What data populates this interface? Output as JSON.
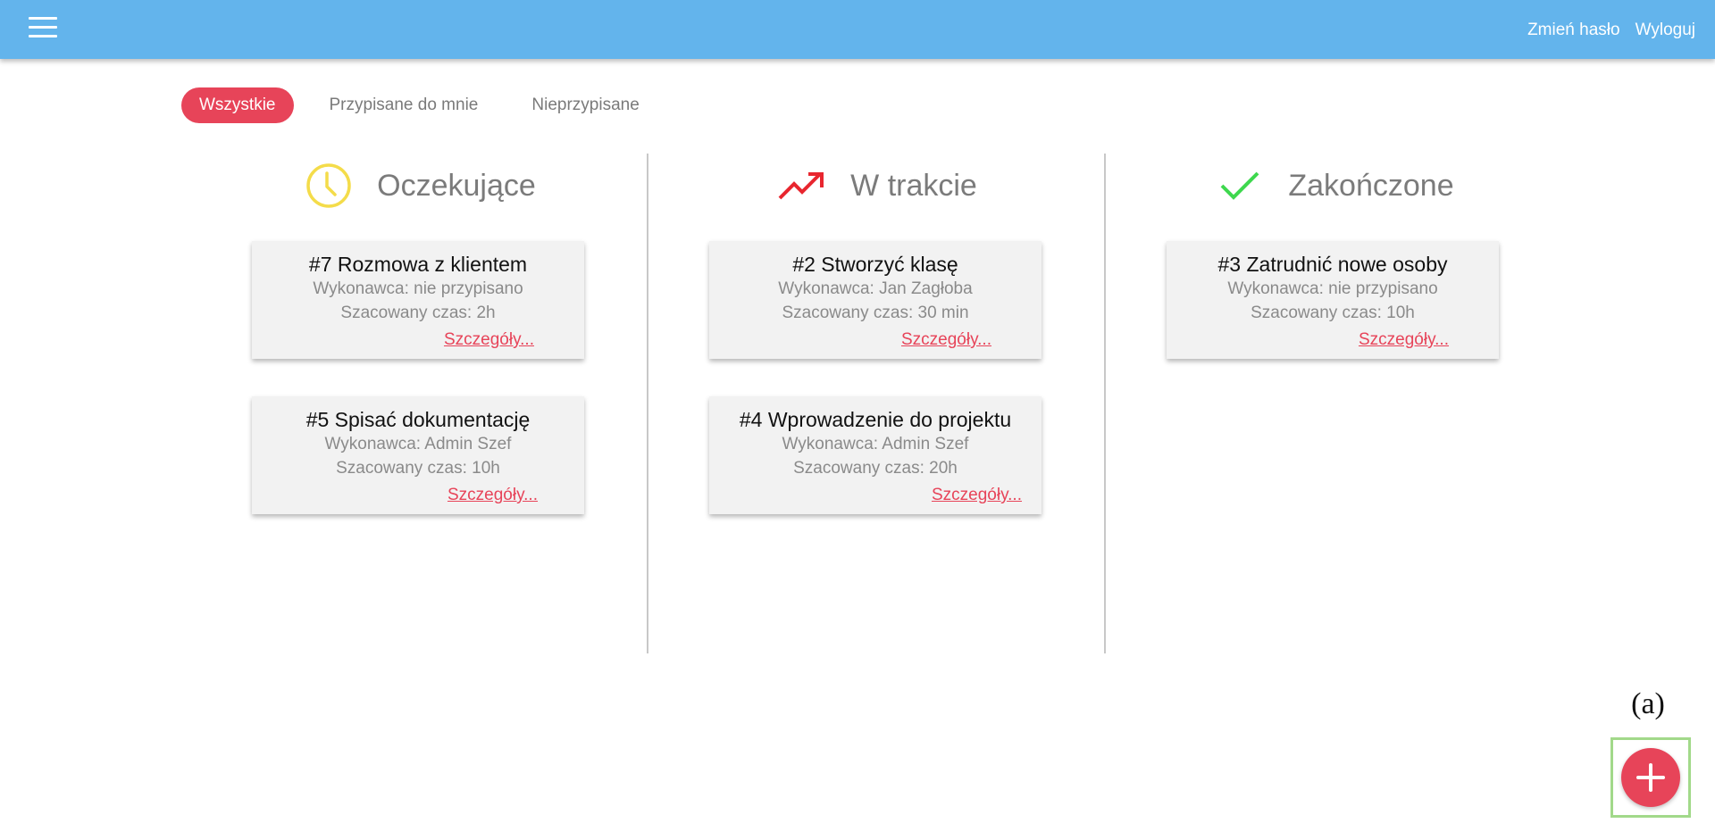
{
  "topbar": {
    "menu_icon": "hamburger-menu-icon",
    "actions": {
      "change_password": "Zmień hasło",
      "logout": "Wyloguj"
    },
    "color": "#63b4ec"
  },
  "filters": {
    "items": [
      "Wszystkie",
      "Przypisane do mnie",
      "Nieprzypisane"
    ],
    "active": "Wszystkie",
    "active_color": "#e74459"
  },
  "columns": [
    {
      "title": "Oczekujące",
      "icon": "clock-icon",
      "icon_color": "#f4dc4a",
      "cards": [
        {
          "title": "#7 Rozmowa z klientem",
          "assignee": "Wykonawca: nie przypisano",
          "estimate": "Szacowany czas: 2h",
          "link": "Szczegóły..."
        },
        {
          "title": "#5 Spisać dokumentację",
          "assignee": "Wykonawca: Admin Szef",
          "estimate": "Szacowany czas: 10h",
          "link": "Szczegóły..."
        }
      ]
    },
    {
      "title": "W trakcie",
      "icon": "trending-up-icon",
      "icon_color": "#e8262f",
      "cards": [
        {
          "title": "#2 Stworzyć klasę",
          "assignee": "Wykonawca: Jan Zagłoba",
          "estimate": "Szacowany czas: 30 min",
          "link": "Szczegóły..."
        },
        {
          "title": "#4 Wprowadzenie do projektu",
          "assignee": "Wykonawca: Admin Szef",
          "estimate": "Szacowany czas: 20h",
          "link": "Szczegóły..."
        }
      ]
    },
    {
      "title": "Zakończone",
      "icon": "checkmark-icon",
      "icon_color": "#3ed84e",
      "cards": [
        {
          "title": "#3 Zatrudnić nowe osoby",
          "assignee": "Wykonawca: nie przypisano",
          "estimate": "Szacowany czas: 10h",
          "link": "Szczegóły..."
        }
      ]
    }
  ],
  "fab": {
    "label": "(a)",
    "icon": "plus-icon",
    "color": "#e74459"
  }
}
